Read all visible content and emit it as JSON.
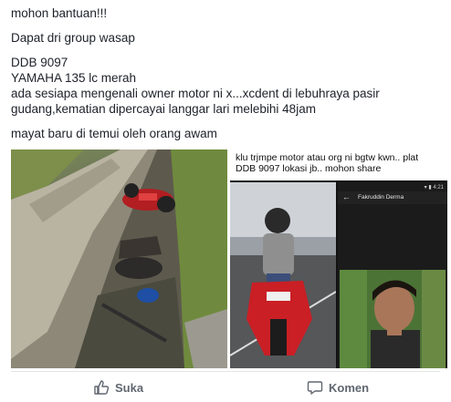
{
  "post": {
    "lines": [
      "mohon bantuan!!!",
      "Dapat dri group wasap",
      "DDB 9097",
      "YAMAHA 135 lc merah",
      "ada sesiapa mengenali owner motor ni x...xcdent di lebuhraya pasir",
      "gudang,kematian dipercayai langgar lari melebihi 48jam",
      "mayat baru di temui oleh orang awam"
    ]
  },
  "media": {
    "caption_lines": [
      "klu trjmpe motor atau org ni bgtw kwn.. plat",
      "DDB 9097 lokasi jb.. mohon share"
    ],
    "phone_contact_name": "Fakruddin Derma"
  },
  "actions": {
    "like_label": "Suka",
    "comment_label": "Komen"
  }
}
